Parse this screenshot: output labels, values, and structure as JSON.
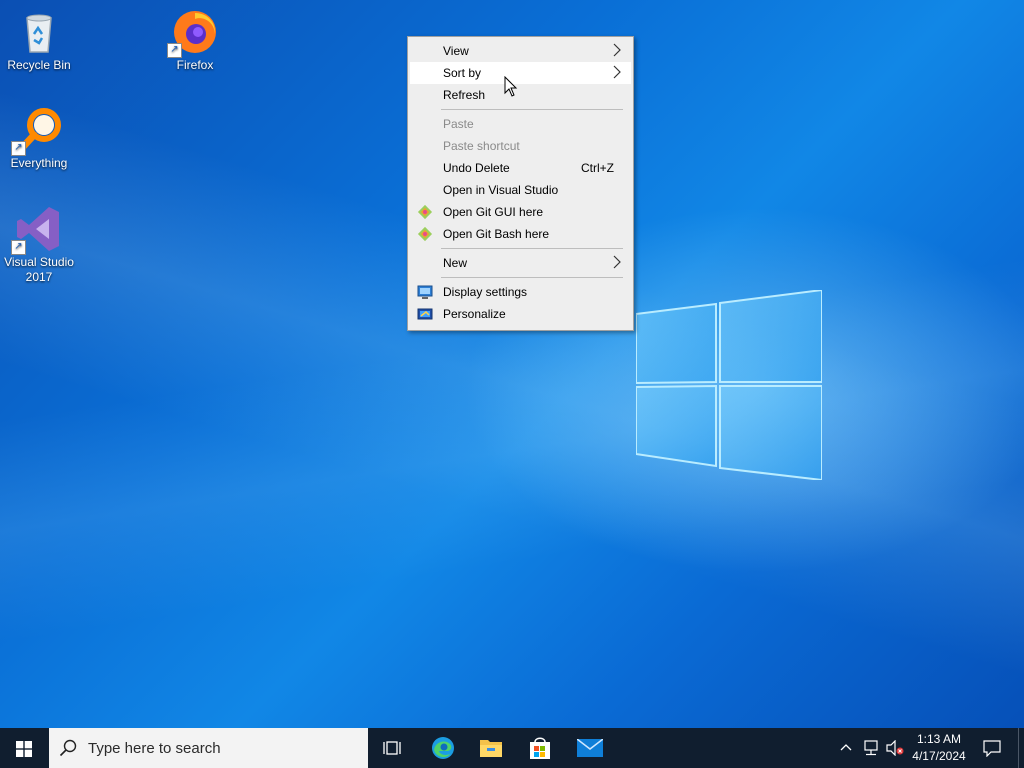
{
  "desktop": {
    "icons": [
      {
        "label": "Recycle Bin",
        "icon": "recycle-bin-icon"
      },
      {
        "label": "Firefox",
        "icon": "firefox-icon"
      },
      {
        "label": "Everything",
        "icon": "everything-search-icon"
      },
      {
        "label": "Visual Studio 2017",
        "icon": "visual-studio-icon"
      }
    ]
  },
  "context_menu": {
    "items": [
      {
        "label": "View",
        "submenu": true
      },
      {
        "label": "Sort by",
        "submenu": true,
        "highlighted": true
      },
      {
        "label": "Refresh"
      },
      {
        "label": "Paste",
        "disabled": true
      },
      {
        "label": "Paste shortcut",
        "disabled": true
      },
      {
        "label": "Undo Delete",
        "shortcut": "Ctrl+Z"
      },
      {
        "label": "Open in Visual Studio"
      },
      {
        "label": "Open Git GUI here",
        "icon": "git-icon"
      },
      {
        "label": "Open Git Bash here",
        "icon": "git-icon"
      },
      {
        "label": "New",
        "submenu": true
      },
      {
        "label": "Display settings",
        "icon": "display-icon"
      },
      {
        "label": "Personalize",
        "icon": "personalize-icon"
      }
    ]
  },
  "taskbar": {
    "search_placeholder": "Type here to search",
    "apps": [
      "task-view-icon",
      "edge-icon",
      "file-explorer-icon",
      "store-icon",
      "mail-icon"
    ],
    "tray": {
      "time": "1:13 AM",
      "date": "4/17/2024",
      "icons": [
        "chevron-up-icon",
        "network-icon",
        "volume-muted-icon",
        "notification-icon"
      ]
    }
  },
  "colors": {
    "taskbar_bg": "#101e2f",
    "menu_bg": "#eeeeee",
    "menu_hover": "#ffffff",
    "desktop_accent": "#0a6fd6"
  }
}
